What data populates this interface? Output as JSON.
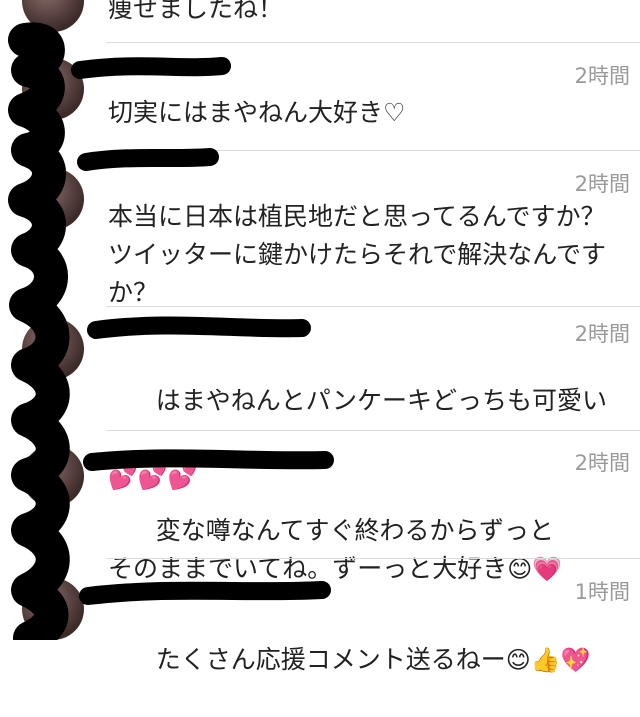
{
  "comments": [
    {
      "username": "",
      "time": "",
      "text": "痩せましたね！"
    },
    {
      "username": "",
      "time": "2時間",
      "text": "切実にはまやねん大好き♡"
    },
    {
      "username": "",
      "time": "2時間",
      "text": "本当に日本は植民地だと思ってるんですか？ ツイッターに鍵かけたらそれで解決なんですか？"
    },
    {
      "username": "",
      "time": "2時間",
      "text": "はまやねんとパンケーキどっちも可愛い",
      "emoji": "💕💕💕"
    },
    {
      "username": "",
      "time": "2時間",
      "text": "変な噂なんてすぐ終わるからずっとそのままでいてね。ずーっと大好き",
      "emoji": "😊💗"
    },
    {
      "username": "",
      "time": "1時間",
      "text": "たくさん応援コメント送るねー",
      "emoji": "😊👍💖"
    }
  ]
}
